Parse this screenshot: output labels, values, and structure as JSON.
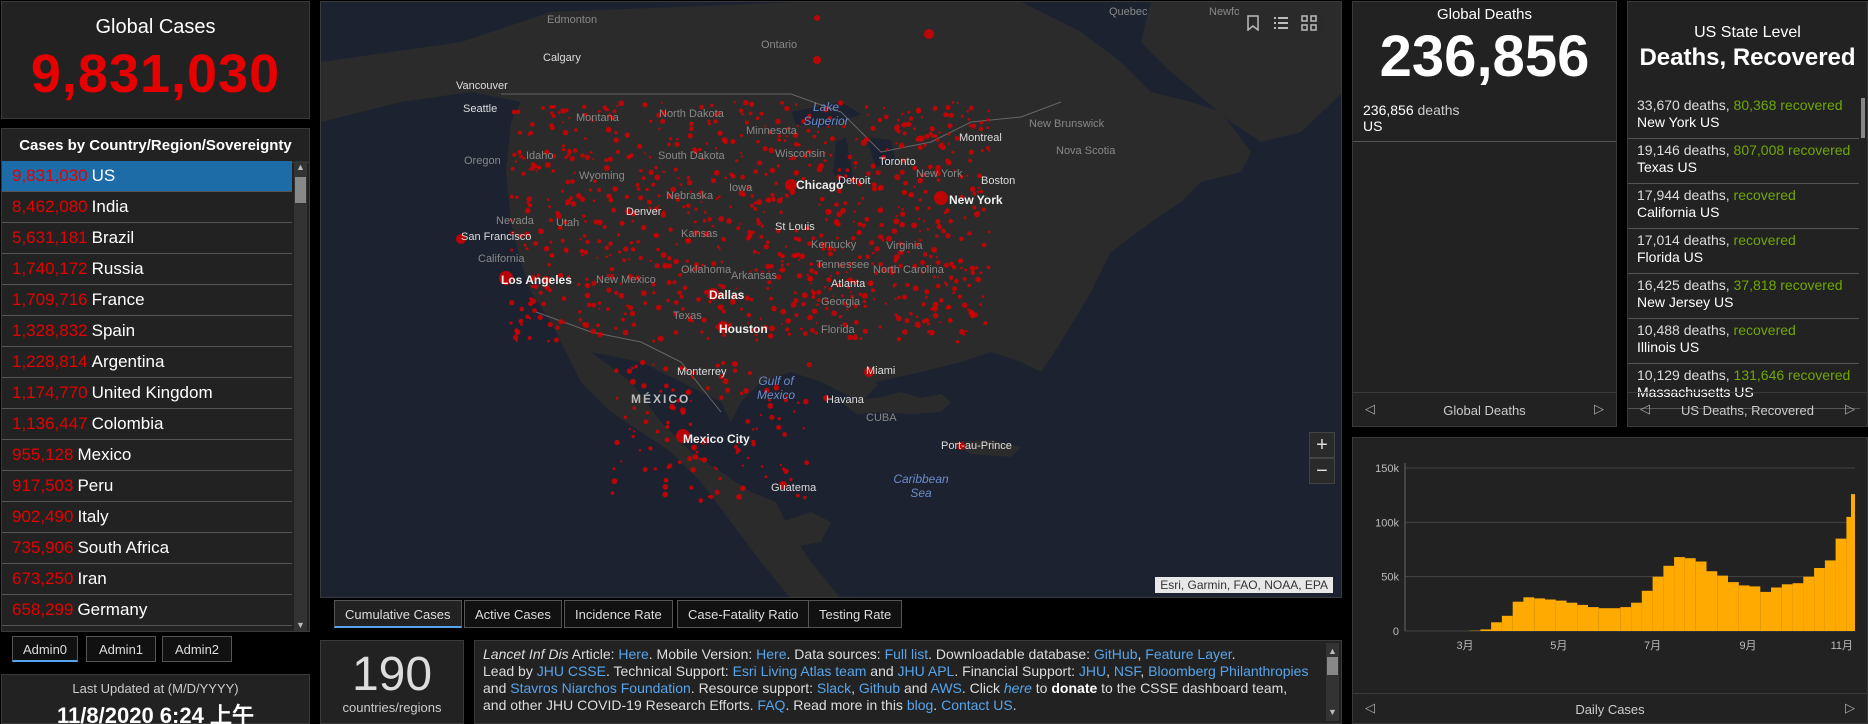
{
  "global_cases": {
    "title": "Global Cases",
    "value": "9,831,030"
  },
  "country_panel": {
    "title": "Cases by Country/Region/Sovereignty",
    "rows": [
      {
        "value": "9,831,030",
        "name": "US"
      },
      {
        "value": "8,462,080",
        "name": "India"
      },
      {
        "value": "5,631,181",
        "name": "Brazil"
      },
      {
        "value": "1,740,172",
        "name": "Russia"
      },
      {
        "value": "1,709,716",
        "name": "France"
      },
      {
        "value": "1,328,832",
        "name": "Spain"
      },
      {
        "value": "1,228,814",
        "name": "Argentina"
      },
      {
        "value": "1,174,770",
        "name": "United Kingdom"
      },
      {
        "value": "1,136,447",
        "name": "Colombia"
      },
      {
        "value": "955,128",
        "name": "Mexico"
      },
      {
        "value": "917,503",
        "name": "Peru"
      },
      {
        "value": "902,490",
        "name": "Italy"
      },
      {
        "value": "735,906",
        "name": "South Africa"
      },
      {
        "value": "673,250",
        "name": "Iran"
      },
      {
        "value": "658,299",
        "name": "Germany"
      }
    ]
  },
  "admin_tabs": [
    "Admin0",
    "Admin1",
    "Admin2"
  ],
  "last_updated": {
    "label": "Last Updated at (M/D/YYYY)",
    "value": "11/8/2020 6:24 上午"
  },
  "map": {
    "attribution": "Esri, Garmin, FAO, NOAA, EPA",
    "labels": {
      "edmonton": "Edmonton",
      "calgary": "Calgary",
      "vancouver": "Vancouver",
      "seattle": "Seattle",
      "ontario": "Ontario",
      "quebec": "Quebec",
      "newfoundland": "Newfo",
      "montana": "Montana",
      "north_dakota": "North Dakota",
      "minnesota": "Minnesota",
      "oregon": "Oregon",
      "idaho": "Idaho",
      "south_dakota": "South Dakota",
      "wisconsin": "Wisconsin",
      "wyoming": "Wyoming",
      "nebraska": "Nebraska",
      "iowa": "Iowa",
      "nevada": "Nevada",
      "utah": "Utah",
      "denver": "Denver",
      "chicago": "Chicago",
      "detroit": "Detroit",
      "toronto": "Toronto",
      "montreal": "Montreal",
      "new_brunswick": "New Brunswick",
      "nova_scotia": "Nova Scotia",
      "new_york_state": "New York",
      "boston": "Boston",
      "new_york": "New York",
      "san_francisco": "San Francisco",
      "california": "California",
      "kansas": "Kansas",
      "st_louis": "St Louis",
      "kentucky": "Kentucky",
      "virginia": "Virginia",
      "los_angeles": "Los Angeles",
      "new_mexico": "New Mexico",
      "oklahoma": "Oklahoma",
      "arkansas": "Arkansas",
      "tennessee": "Tennessee",
      "north_carolina": "North Carolina",
      "dallas": "Dallas",
      "atlanta": "Atlanta",
      "georgia": "Georgia",
      "texas": "Texas",
      "houston": "Houston",
      "florida": "Florida",
      "monterrey": "Monterrey",
      "mexico": "MÉXICO",
      "miami": "Miami",
      "havana": "Havana",
      "cuba": "CUBA",
      "mexico_city": "Mexico City",
      "port_au_prince": "Port-au-Prince",
      "guatemala": "Guatema",
      "lake_superior": "Lake Superior",
      "gulf_of_mexico": "Gulf of Mexico",
      "caribbean_sea": "Caribbean Sea"
    }
  },
  "map_tabs": [
    "Cumulative Cases",
    "Active Cases",
    "Incidence Rate",
    "Case-Fatality Ratio",
    "Testing Rate"
  ],
  "countries_count": {
    "value": "190",
    "label": "countries/regions"
  },
  "info": {
    "journal": "Lancet Inf Dis",
    "article": " Article: ",
    "here1": "Here",
    "mobile": ". Mobile Version: ",
    "here2": "Here",
    "sources": ". Data sources: ",
    "full_list": "Full list",
    "download": ". Downloadable database: ",
    "github": "GitHub",
    "comma": ", ",
    "feature_layer": "Feature Layer",
    "period": ".",
    "led_by": "Lead by ",
    "jhu_csse": "JHU CSSE",
    "tech": ". Technical Support: ",
    "esri_team": "Esri Living Atlas team",
    "and1": " and ",
    "jhu_apl": "JHU APL",
    "fin": ". Financial Support: ",
    "jhu": "JHU",
    "nsf": "NSF",
    "bloomberg": "Bloomberg Philanthropies",
    "and2": "and ",
    "stavros": "Stavros Niarchos Foundation",
    "res": ". Resource support: ",
    "slack": "Slack",
    "github2": "Github",
    "and3": " and ",
    "aws": "AWS",
    "click": ". Click ",
    "here3": "here",
    "to": " to ",
    "donate": "donate",
    "rest": " to the CSSE dashboard team,",
    "line4a": "and other JHU COVID-19 Research Efforts. ",
    "faq": "FAQ",
    "readmore": ". Read more in this ",
    "blog": "blog",
    "dot": ". ",
    "contact": "Contact US",
    "dot2": "."
  },
  "global_deaths": {
    "title": "Global Deaths",
    "value": "236,856",
    "item_value": "236,856",
    "item_unit": "deaths",
    "item_place": "US",
    "pager_label": "Global Deaths"
  },
  "us_state": {
    "title1": "US State Level",
    "title2": "Deaths, Recovered",
    "rows": [
      {
        "deaths": "33,670",
        "deaths_label": "deaths,",
        "recovered": "80,368",
        "recovered_label": "recovered",
        "place": "New York US"
      },
      {
        "deaths": "19,146",
        "deaths_label": "deaths,",
        "recovered": "807,008",
        "recovered_label": "recovered",
        "place": "Texas US"
      },
      {
        "deaths": "17,944",
        "deaths_label": "deaths,",
        "recovered": "",
        "recovered_label": "recovered",
        "place": "California US"
      },
      {
        "deaths": "17,014",
        "deaths_label": "deaths,",
        "recovered": "",
        "recovered_label": "recovered",
        "place": "Florida US"
      },
      {
        "deaths": "16,425",
        "deaths_label": "deaths,",
        "recovered": "37,818",
        "recovered_label": "recovered",
        "place": "New Jersey US"
      },
      {
        "deaths": "10,488",
        "deaths_label": "deaths,",
        "recovered": "",
        "recovered_label": "recovered",
        "place": "Illinois US"
      },
      {
        "deaths": "10,129",
        "deaths_label": "deaths,",
        "recovered": "131,646",
        "recovered_label": "recovered",
        "place": "Massachusetts US"
      }
    ],
    "pager_label": "US Deaths, Recovered"
  },
  "colors": {
    "accent": "#e60000",
    "recovered": "#70a800",
    "link": "#56a5ec",
    "bar": "#ffaa00",
    "selected": "#1d6ca8"
  },
  "chart_data": {
    "type": "bar",
    "xlabel": "Daily Cases",
    "x_ticks": [
      "3月",
      "5月",
      "7月",
      "9月",
      "11月"
    ],
    "y_ticks": [
      "0",
      "50k",
      "100k",
      "150k"
    ],
    "ylim": [
      0,
      150000
    ],
    "x": [
      "2020-01-22",
      "2020-01-29",
      "2020-02-05",
      "2020-02-12",
      "2020-02-19",
      "2020-02-26",
      "2020-03-04",
      "2020-03-11",
      "2020-03-18",
      "2020-03-25",
      "2020-04-01",
      "2020-04-08",
      "2020-04-15",
      "2020-04-22",
      "2020-04-29",
      "2020-05-06",
      "2020-05-13",
      "2020-05-20",
      "2020-05-27",
      "2020-06-03",
      "2020-06-10",
      "2020-06-17",
      "2020-06-24",
      "2020-07-01",
      "2020-07-08",
      "2020-07-15",
      "2020-07-22",
      "2020-07-29",
      "2020-08-05",
      "2020-08-12",
      "2020-08-19",
      "2020-08-26",
      "2020-09-02",
      "2020-09-09",
      "2020-09-16",
      "2020-09-23",
      "2020-09-30",
      "2020-10-07",
      "2020-10-14",
      "2020-10-21",
      "2020-10-28",
      "2020-11-04",
      "2020-11-07"
    ],
    "values": [
      0,
      0,
      0,
      0,
      0,
      0,
      300,
      1500,
      8000,
      14000,
      27000,
      31000,
      30000,
      29000,
      28000,
      26000,
      24000,
      22000,
      21000,
      21000,
      22000,
      26000,
      37000,
      50000,
      60000,
      68000,
      67000,
      64000,
      55000,
      51000,
      45000,
      42000,
      41000,
      36000,
      40000,
      43000,
      44000,
      50000,
      58000,
      65000,
      85000,
      105000,
      126000
    ]
  }
}
